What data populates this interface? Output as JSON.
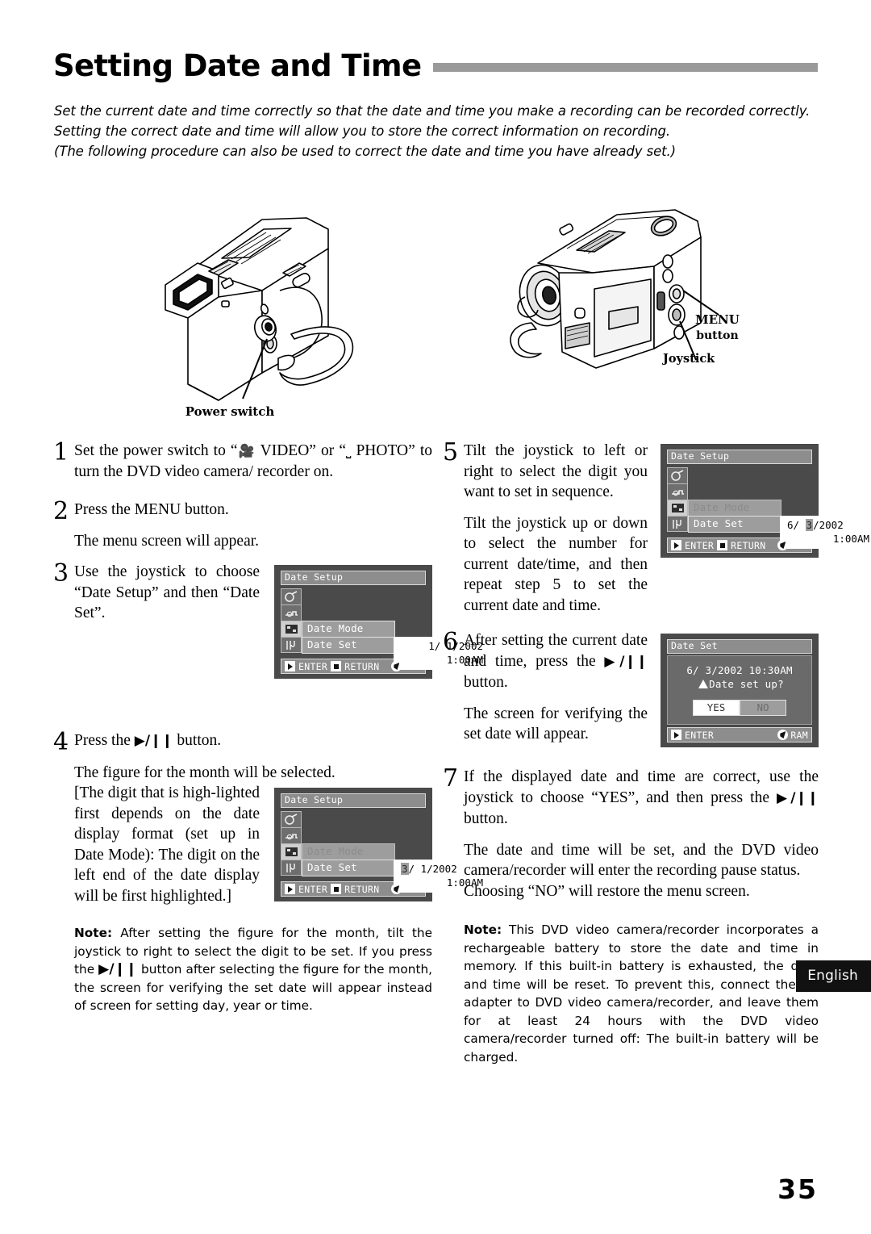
{
  "title": "Setting Date and Time",
  "intro": [
    "Set the current date and time correctly so that the date and time you make a recording can be recorded correctly.",
    "Setting the correct date and time will allow you to store the correct information on recording.",
    "(The following procedure can also be used to correct the date and time you have already set.)"
  ],
  "illustrations": {
    "left_callout": "Power switch",
    "right_callout_menu_line1": "MENU",
    "right_callout_menu_line2": "button",
    "right_callout_joystick": "Joystick"
  },
  "steps": {
    "s1": {
      "num": "1",
      "text_a": "Set  the  power  switch  to  “",
      "video_icon": "video-camera-icon",
      "text_b": " VIDEO”  or  “",
      "photo_icon": "photo-card-icon",
      "text_c": " PHOTO”  to  turn  the  DVD  video  camera/ recorder on."
    },
    "s2": {
      "num": "2",
      "text": "Press the MENU button.",
      "result": "The menu screen will appear."
    },
    "s3": {
      "num": "3",
      "text": "Use  the  joystick  to  choose “Date Setup” and then “Date Set”."
    },
    "s4": {
      "num": "4",
      "text_pre": "Press the ",
      "button_glyph": "▶/❙❙",
      "text_post": " button.",
      "result_line": "The figure for the month will be selected.",
      "result_bracket": "[The digit that is high-lighted first depends on the date display format (set up in Date Mode): The digit on the left end of the date display will be first highlighted.]"
    },
    "s5": {
      "num": "5",
      "text": "Tilt the joystick to left or right to select the digit you want to set in sequence.",
      "text2": "Tilt the joystick up or down to select the number for current date/time, and then repeat step 5 to set the current date and time."
    },
    "s6": {
      "num": "6",
      "text_pre": "After setting the current date and time, press the ",
      "button_glyph": "▶/❙❙",
      "text_post": " button.",
      "result": "The screen for verifying the set date will appear."
    },
    "s7": {
      "num": "7",
      "text_pre": "If the displayed date and time are correct, use the joystick to choose “YES”, and then press the ",
      "button_glyph": "▶/❙❙",
      "text_post": " button.",
      "result1": "The date and time will be set, and the DVD video camera/recorder will enter the recording pause status.",
      "result2": "Choosing “NO” will restore the menu screen."
    }
  },
  "notes": {
    "note_label": "Note:",
    "note1_pre": "  After setting the figure for the month, tilt the joystick to right to select the digit to be set. If you press the ",
    "note1_glyph": "▶/❙❙",
    "note1_post": " button after selecting the figure for the month, the screen for verifying the set date will appear instead of screen for setting day, year or time.",
    "note2": "  This DVD video camera/recorder incorporates a rechargeable battery to store the date and time in memory. If this built-in battery is exhausted, the date and time will be reset. To prevent this, connect the AC adapter to DVD video camera/recorder, and leave them for at least 24 hours with the DVD video camera/recorder turned off: The built-in battery will be charged."
  },
  "lcd_screens": {
    "screen3": {
      "title": "Date Setup",
      "menu_items": [
        "Date Mode",
        "Date Set"
      ],
      "value_date": "1/ 1/2002",
      "value_time": "1:00AM",
      "highlight": "none",
      "bar_enter": "ENTER",
      "bar_return": "RETURN",
      "bar_disc": "RAM"
    },
    "screen4": {
      "title": "Date Setup",
      "menu_items": [
        "Date Mode",
        "Date Set"
      ],
      "value_month": "3",
      "value_rest": "/ 1/2002",
      "value_time": "1:00AM",
      "highlight": "month",
      "bar_enter": "ENTER",
      "bar_return": "RETURN",
      "bar_disc": "RAM"
    },
    "screen5": {
      "title": "Date Setup",
      "menu_items": [
        "Date Mode",
        "Date Set"
      ],
      "value_pre": "6/ ",
      "value_day": "3",
      "value_post": "/2002",
      "value_time": "1:00AM",
      "highlight": "day",
      "bar_enter": "ENTER",
      "bar_return": "RETURN",
      "bar_disc": "RAM"
    },
    "screen6": {
      "title": "Date Set",
      "datetime": "6/ 3/2002 10:30AM",
      "question": "Date set up?",
      "yes": "YES",
      "no": "NO",
      "selected": "NO",
      "bar_enter": "ENTER",
      "bar_disc": "RAM"
    }
  },
  "language_tab": "English",
  "page_number": "35",
  "colors": {
    "title_rule": "#9a9a9a",
    "lcd_background": "#4a4a4a",
    "lcd_bar": "#8d8d8d",
    "tab_background": "#111111"
  }
}
